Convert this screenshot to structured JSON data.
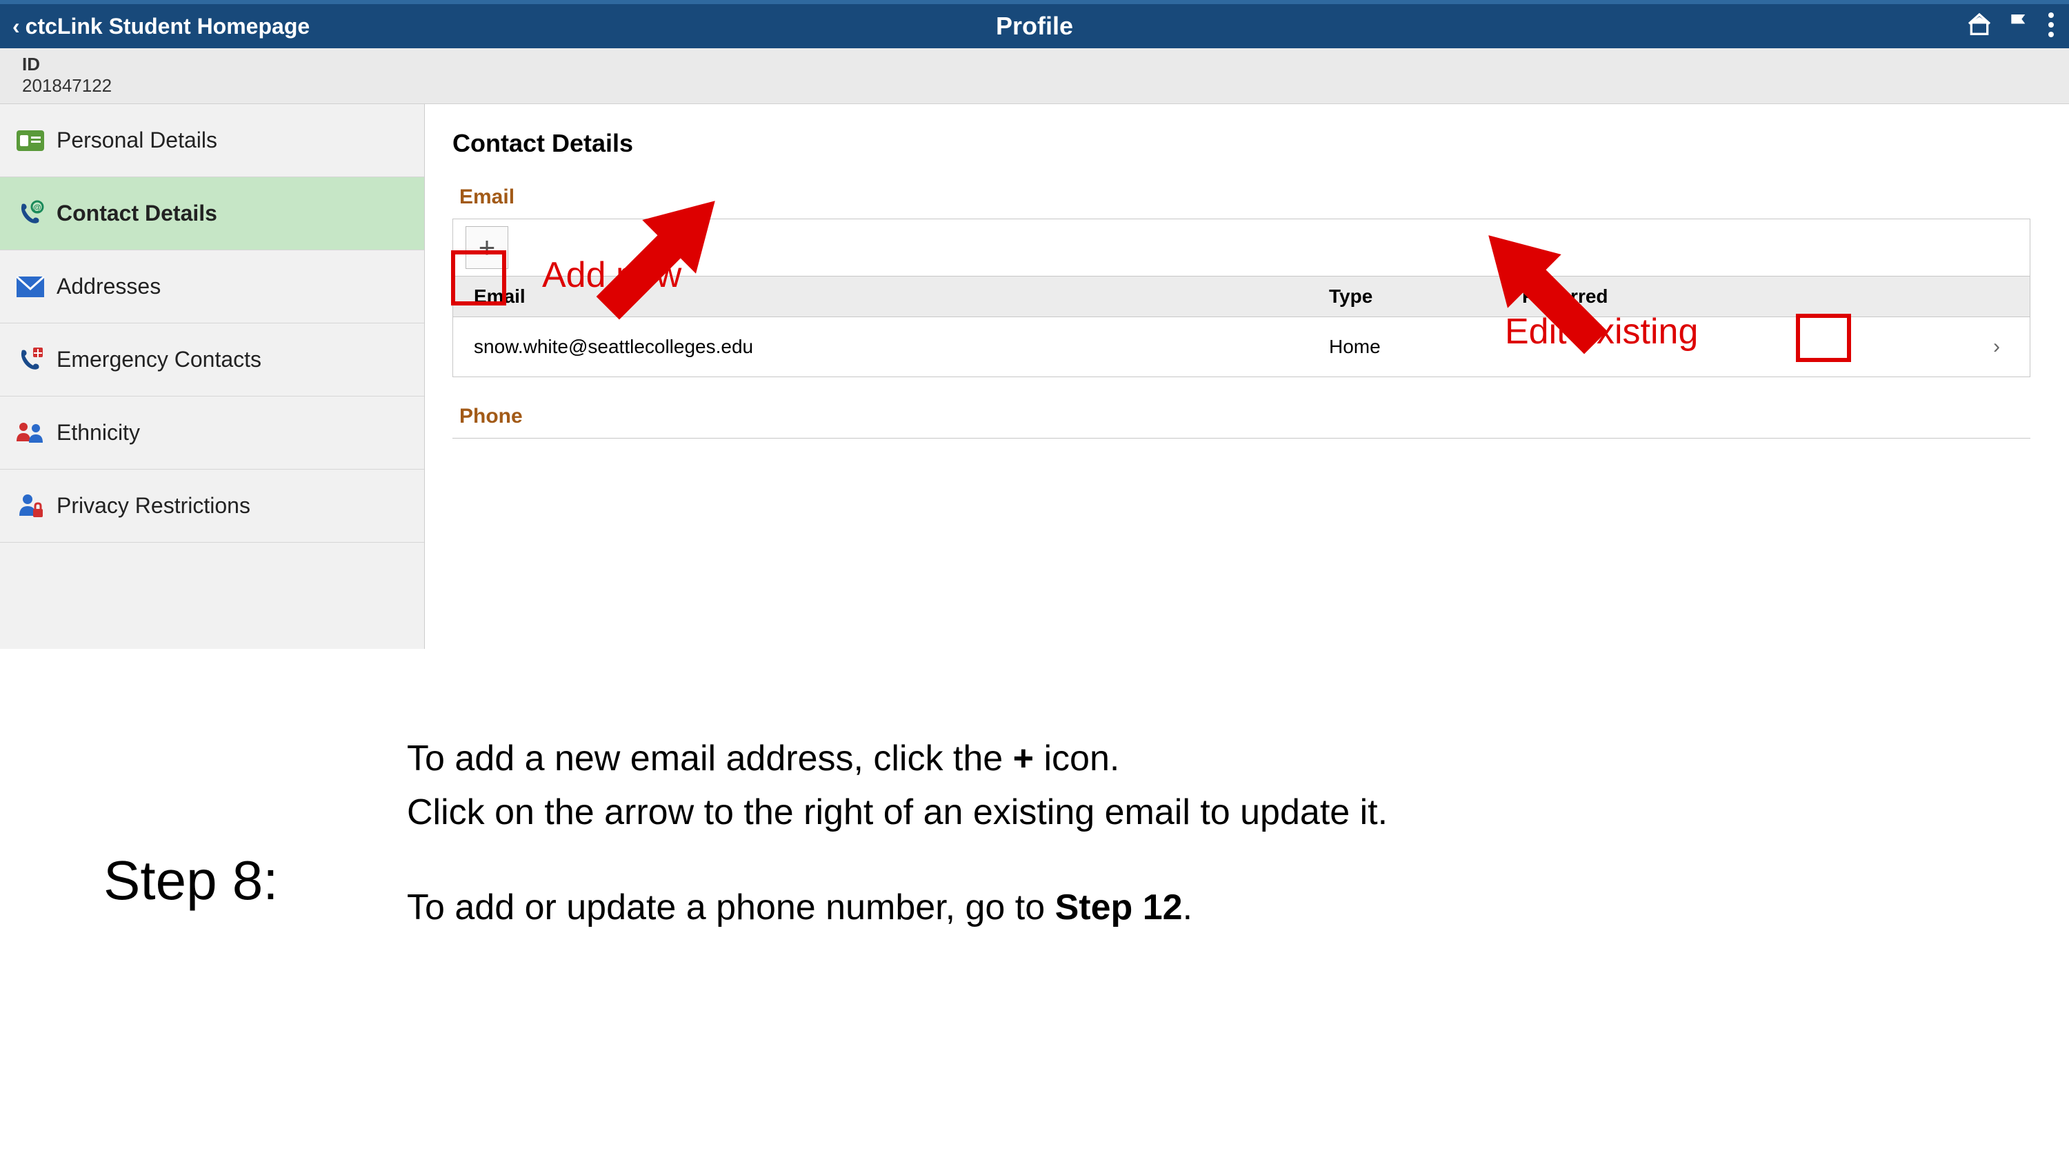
{
  "topbar": {
    "back_label": "ctcLink Student Homepage",
    "title": "Profile"
  },
  "idbar": {
    "label": "ID",
    "value": "201847122"
  },
  "sidebar": {
    "items": [
      {
        "label": "Personal Details"
      },
      {
        "label": "Contact Details"
      },
      {
        "label": "Addresses"
      },
      {
        "label": "Emergency Contacts"
      },
      {
        "label": "Ethnicity"
      },
      {
        "label": "Privacy Restrictions"
      }
    ]
  },
  "main": {
    "title": "Contact Details",
    "email_section": "Email",
    "phone_section": "Phone",
    "columns": {
      "email": "Email",
      "type": "Type",
      "preferred": "Preferred"
    },
    "rows": [
      {
        "email": "snow.white@seattlecolleges.edu",
        "type": "Home",
        "preferred": ""
      }
    ]
  },
  "annotations": {
    "add_new": "Add new",
    "edit_existing": "Edit existing"
  },
  "instructions": {
    "step_label": "Step 8:",
    "line1a": "To add a new email address, click the ",
    "line1b": "+",
    "line1c": " icon.",
    "line2": "Click on the arrow to the right of an existing email to update it.",
    "line3a": "To add or update a phone number, go to ",
    "line3b": "Step 12",
    "line3c": "."
  }
}
